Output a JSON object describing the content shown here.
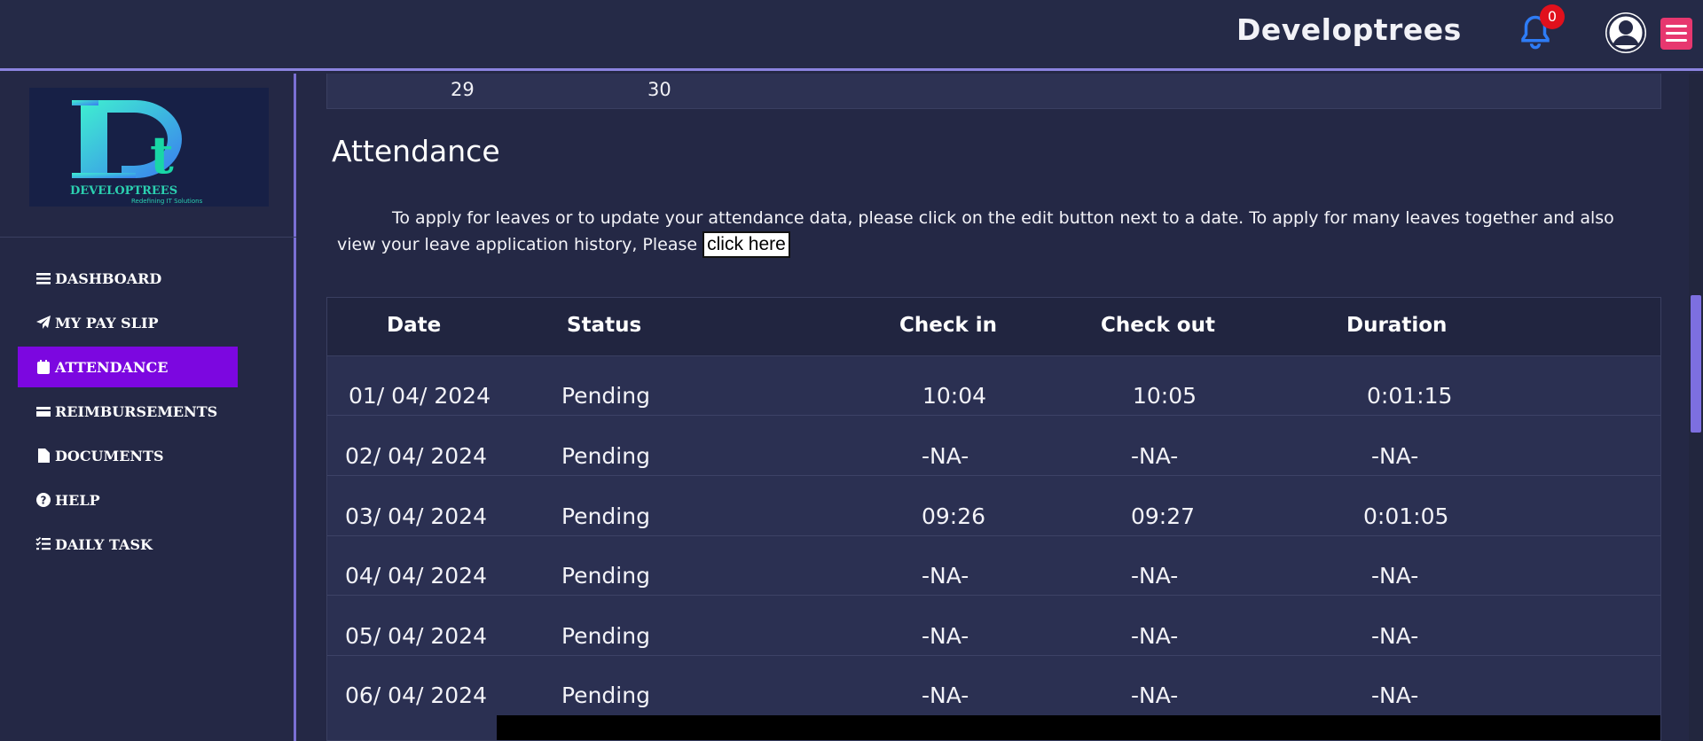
{
  "header": {
    "brand": "Developtrees",
    "notification_count": "0"
  },
  "logo": {
    "text": "DEVELOPTREES",
    "tagline": "Redefining IT Solutions"
  },
  "sidebar": {
    "items": [
      {
        "label": "DASHBOARD",
        "icon": "bars-icon"
      },
      {
        "label": "MY PAY SLIP",
        "icon": "paper-plane-icon"
      },
      {
        "label": "ATTENDANCE",
        "icon": "calendar-icon",
        "active": true
      },
      {
        "label": "REIMBURSEMENTS",
        "icon": "credit-card-icon"
      },
      {
        "label": "DOCUMENTS",
        "icon": "file-icon"
      },
      {
        "label": "HELP",
        "icon": "question-circle-icon"
      },
      {
        "label": "DAILY TASK",
        "icon": "task-list-icon"
      }
    ]
  },
  "calendar": {
    "days": [
      "29",
      "30"
    ]
  },
  "main": {
    "title": "Attendance",
    "info_text": "To apply for leaves or to update your attendance data, please click on the edit button next to a date. To apply for many leaves together and also view your leave application history, Please",
    "link_label": "click here"
  },
  "table": {
    "headers": [
      "Date",
      "Status",
      "Check in",
      "Check out",
      "Duration"
    ],
    "rows": [
      [
        "01/ 04/ 2024",
        "Pending",
        "10:04",
        "10:05",
        "0:01:15"
      ],
      [
        "02/ 04/ 2024",
        "Pending",
        "-NA-",
        "-NA-",
        "-NA-"
      ],
      [
        "03/ 04/ 2024",
        "Pending",
        "09:26",
        "09:27",
        "0:01:05"
      ],
      [
        "04/ 04/ 2024",
        "Pending",
        "-NA-",
        "-NA-",
        "-NA-"
      ],
      [
        "05/ 04/ 2024",
        "Pending",
        "-NA-",
        "-NA-",
        "-NA-"
      ],
      [
        "06/ 04/ 2024",
        "Pending",
        "-NA-",
        "-NA-",
        "-NA-"
      ]
    ]
  },
  "colors": {
    "background": "#242845",
    "active_nav": "#7c07e0",
    "accent": "#8c84e0",
    "menu_button": "#e7376f",
    "badge": "#e1101c"
  }
}
